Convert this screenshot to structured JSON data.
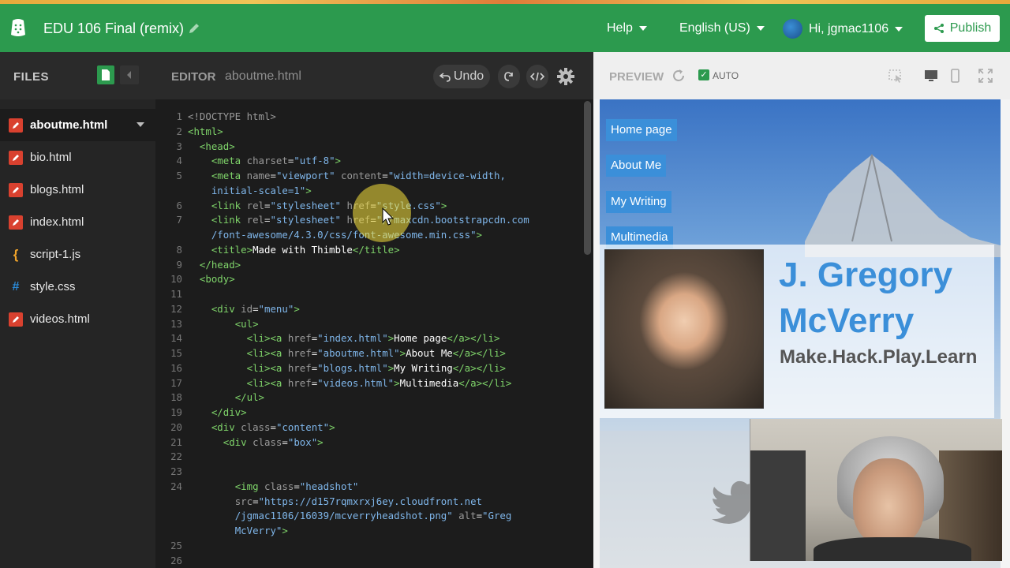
{
  "header": {
    "project_title": "EDU 106 Final (remix)",
    "menu_help": "Help",
    "menu_language": "English (US)",
    "user_greeting": "Hi, jgmac1106",
    "publish_label": "Publish"
  },
  "files_panel": {
    "title": "FILES",
    "items": [
      {
        "name": "aboutme.html",
        "type": "html",
        "active": true
      },
      {
        "name": "bio.html",
        "type": "html"
      },
      {
        "name": "blogs.html",
        "type": "html"
      },
      {
        "name": "index.html",
        "type": "html"
      },
      {
        "name": "script-1.js",
        "type": "js"
      },
      {
        "name": "style.css",
        "type": "css"
      },
      {
        "name": "videos.html",
        "type": "html"
      }
    ]
  },
  "editor": {
    "title": "EDITOR",
    "filename": "aboutme.html",
    "undo_label": "Undo",
    "code_lines": [
      {
        "n": "1",
        "html": "<span class='attr'>&lt;!DOCTYPE html&gt;</span>"
      },
      {
        "n": "2",
        "html": "<span class='tag'>&lt;html&gt;</span>"
      },
      {
        "n": "3",
        "html": "  <span class='tag'>&lt;head&gt;</span>"
      },
      {
        "n": "4",
        "html": "    <span class='tag'>&lt;meta</span> <span class='attr'>charset</span>=<span class='str'>\"utf-8\"</span><span class='tag'>&gt;</span>"
      },
      {
        "n": "5",
        "html": "    <span class='tag'>&lt;meta</span> <span class='attr'>name</span>=<span class='str'>\"viewport\"</span> <span class='attr'>content</span>=<span class='str'>\"width=device-width,</span>"
      },
      {
        "n": "",
        "html": "    <span class='str'>initial-scale=1\"</span><span class='tag'>&gt;</span>"
      },
      {
        "n": "6",
        "html": "    <span class='tag'>&lt;link</span> <span class='attr'>rel</span>=<span class='str'>\"stylesheet\"</span> <span class='attr'>href</span>=<span class='str'>\"style.css\"</span><span class='tag'>&gt;</span>"
      },
      {
        "n": "7",
        "html": "    <span class='tag'>&lt;link</span> <span class='attr'>rel</span>=<span class='str'>\"stylesheet\"</span> <span class='attr'>href</span>=<span class='str'>\"//maxcdn.bootstrapcdn.com</span>"
      },
      {
        "n": "",
        "html": "    <span class='str'>/font-awesome/4.3.0/css/font-awesome.min.css\"</span><span class='tag'>&gt;</span>"
      },
      {
        "n": "8",
        "html": "    <span class='tag'>&lt;title&gt;</span><span class='txt'>Made with Thimble</span><span class='tag'>&lt;/title&gt;</span>"
      },
      {
        "n": "9",
        "html": "  <span class='tag'>&lt;/head&gt;</span>"
      },
      {
        "n": "10",
        "html": "  <span class='tag'>&lt;body&gt;</span>"
      },
      {
        "n": "11",
        "html": ""
      },
      {
        "n": "12",
        "html": "    <span class='tag'>&lt;div</span> <span class='attr'>id</span>=<span class='str'>\"menu\"</span><span class='tag'>&gt;</span>"
      },
      {
        "n": "13",
        "html": "        <span class='tag'>&lt;ul&gt;</span>"
      },
      {
        "n": "14",
        "html": "          <span class='tag'>&lt;li&gt;&lt;a</span> <span class='attr'>href</span>=<span class='str'>\"index.html\"</span><span class='tag'>&gt;</span><span class='txt'>Home page</span><span class='tag'>&lt;/a&gt;&lt;/li&gt;</span>"
      },
      {
        "n": "15",
        "html": "          <span class='tag'>&lt;li&gt;&lt;a</span> <span class='attr'>href</span>=<span class='str'>\"aboutme.html\"</span><span class='tag'>&gt;</span><span class='txt'>About Me</span><span class='tag'>&lt;/a&gt;&lt;/li&gt;</span>"
      },
      {
        "n": "16",
        "html": "          <span class='tag'>&lt;li&gt;&lt;a</span> <span class='attr'>href</span>=<span class='str'>\"blogs.html\"</span><span class='tag'>&gt;</span><span class='txt'>My Writing</span><span class='tag'>&lt;/a&gt;&lt;/li&gt;</span>"
      },
      {
        "n": "17",
        "html": "          <span class='tag'>&lt;li&gt;&lt;a</span> <span class='attr'>href</span>=<span class='str'>\"videos.html\"</span><span class='tag'>&gt;</span><span class='txt'>Multimedia</span><span class='tag'>&lt;/a&gt;&lt;/li&gt;</span>"
      },
      {
        "n": "18",
        "html": "        <span class='tag'>&lt;/ul&gt;</span>"
      },
      {
        "n": "19",
        "html": "    <span class='tag'>&lt;/div&gt;</span>"
      },
      {
        "n": "20",
        "html": "    <span class='tag'>&lt;div</span> <span class='attr'>class</span>=<span class='str'>\"content\"</span><span class='tag'>&gt;</span>"
      },
      {
        "n": "21",
        "html": "      <span class='tag'>&lt;div</span> <span class='attr'>class</span>=<span class='str'>\"box\"</span><span class='tag'>&gt;</span>"
      },
      {
        "n": "22",
        "html": ""
      },
      {
        "n": "23",
        "html": ""
      },
      {
        "n": "24",
        "html": "        <span class='tag'>&lt;img</span> <span class='attr'>class</span>=<span class='str'>\"headshot\"</span>"
      },
      {
        "n": "",
        "html": "        <span class='attr'>src</span>=<span class='str'>\"https://d157rqmxrxj6ey.cloudfront.net</span>"
      },
      {
        "n": "",
        "html": "        <span class='str'>/jgmac1106/16039/mcverryheadshot.png\"</span> <span class='attr'>alt</span>=<span class='str'>\"Greg</span>"
      },
      {
        "n": "",
        "html": "        <span class='str'>McVerry\"</span><span class='tag'>&gt;</span>"
      },
      {
        "n": "25",
        "html": ""
      },
      {
        "n": "26",
        "html": ""
      }
    ]
  },
  "preview": {
    "title": "PREVIEW",
    "auto_label": "AUTO",
    "nav": [
      "Home page",
      "About Me",
      "My Writing",
      "Multimedia"
    ],
    "name": "J. Gregory McVerry",
    "tagline": "Make.Hack.Play.Learn"
  },
  "colors": {
    "topbar": "#2c9a4e",
    "accent_blue": "#3b8fd9",
    "html_icon": "#d9412f"
  }
}
